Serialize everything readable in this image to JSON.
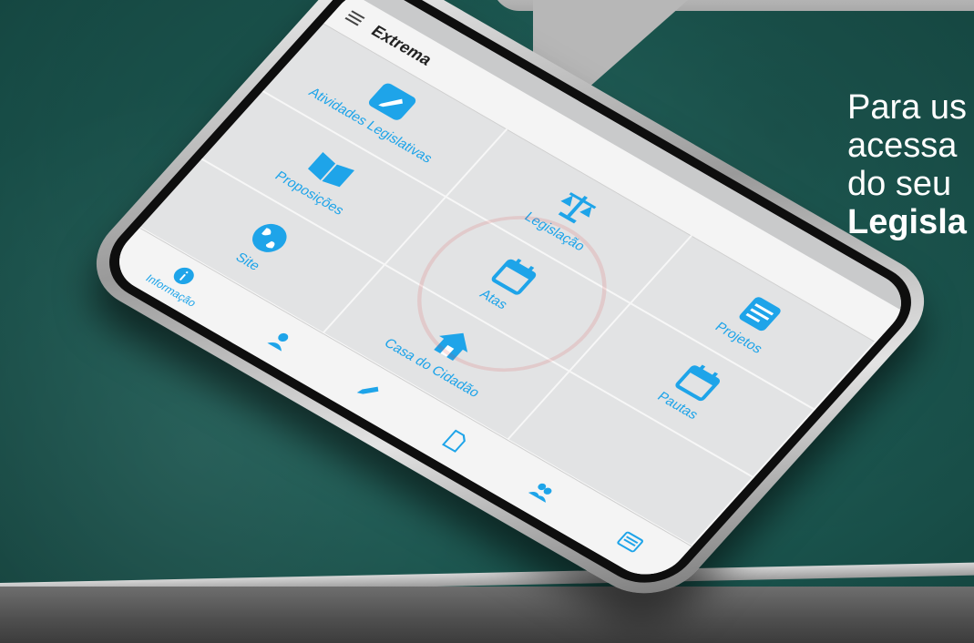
{
  "headline": {
    "line1": "Para us",
    "line2": "acessa",
    "line3": "do seu",
    "line4": "Legisla"
  },
  "phone": {
    "app_title": "Extrema",
    "tiles": [
      {
        "label": "Atividades Legislativas",
        "icon": "pencil-icon"
      },
      {
        "label": "Legislação",
        "icon": "scales-icon"
      },
      {
        "label": "Projetos",
        "icon": "document-stack-icon"
      },
      {
        "label": "Proposições",
        "icon": "open-book-icon"
      },
      {
        "label": "Atas",
        "icon": "calendar-icon"
      },
      {
        "label": "Pautas",
        "icon": "calendar-icon"
      },
      {
        "label": "Site",
        "icon": "globe-icon"
      },
      {
        "label": "Casa do Cidadão",
        "icon": "house-icon"
      }
    ],
    "bottom_nav": [
      {
        "label": "Informação",
        "icon": "info-icon"
      },
      {
        "label": "",
        "icon": "user-icon"
      },
      {
        "label": "",
        "icon": "pencil-icon"
      },
      {
        "label": "",
        "icon": "document-icon"
      },
      {
        "label": "",
        "icon": "users-icon"
      },
      {
        "label": "",
        "icon": "newspaper-icon"
      }
    ]
  },
  "colors": {
    "accent": "#1ea4e9",
    "background": "#1d5b54",
    "screen": "#e2e3e4"
  }
}
